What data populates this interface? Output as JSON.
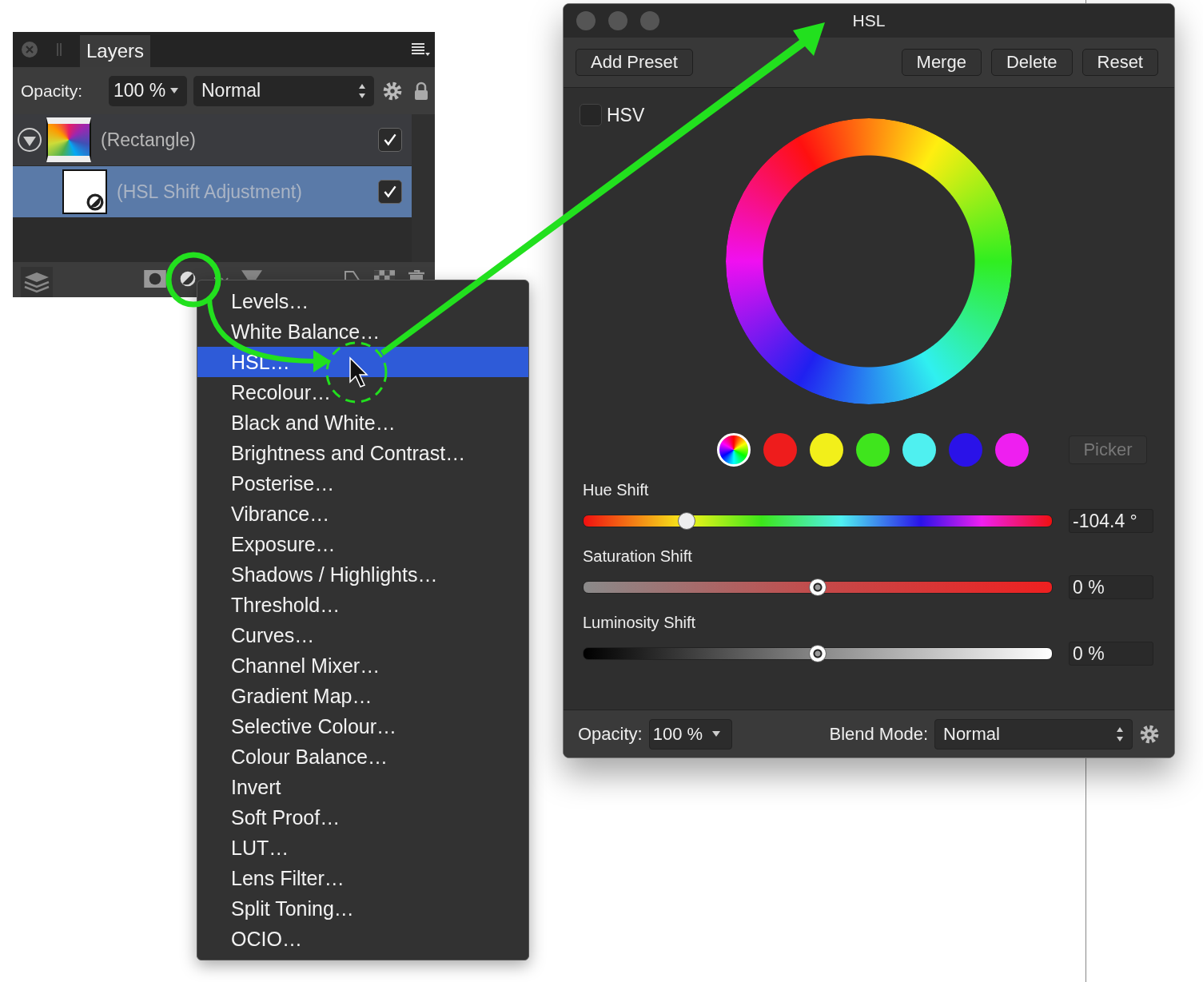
{
  "layers_panel": {
    "tab": "Layers",
    "opacity_label": "Opacity:",
    "opacity": "100 %",
    "blend_mode": "Normal",
    "layers": [
      {
        "kind": "shape",
        "name": "(Rectangle)",
        "expanded": true,
        "visible": true,
        "selected": false,
        "children": [
          {
            "kind": "adjustment",
            "name": "(HSL Shift Adjustment)",
            "visible": true,
            "selected": true
          }
        ]
      }
    ]
  },
  "menu": {
    "items": [
      {
        "label": "Levels…",
        "selected": false
      },
      {
        "label": "White Balance…",
        "selected": false
      },
      {
        "label": "HSL…",
        "selected": true
      },
      {
        "label": "Recolour…",
        "selected": false
      },
      {
        "label": "Black and White…",
        "selected": false
      },
      {
        "label": "Brightness and Contrast…",
        "selected": false
      },
      {
        "label": "Posterise…",
        "selected": false
      },
      {
        "label": "Vibrance…",
        "selected": false
      },
      {
        "label": "Exposure…",
        "selected": false
      },
      {
        "label": "Shadows / Highlights…",
        "selected": false
      },
      {
        "label": "Threshold…",
        "selected": false
      },
      {
        "label": "Curves…",
        "selected": false
      },
      {
        "label": "Channel Mixer…",
        "selected": false
      },
      {
        "label": "Gradient Map…",
        "selected": false
      },
      {
        "label": "Selective Colour…",
        "selected": false
      },
      {
        "label": "Colour Balance…",
        "selected": false
      },
      {
        "label": "Invert",
        "selected": false
      },
      {
        "label": "Soft Proof…",
        "selected": false
      },
      {
        "label": "LUT…",
        "selected": false
      },
      {
        "label": "Lens Filter…",
        "selected": false
      },
      {
        "label": "Split Toning…",
        "selected": false
      },
      {
        "label": "OCIO…",
        "selected": false
      }
    ]
  },
  "hsl_window": {
    "title": "HSL",
    "buttons": [
      "Add Preset",
      "Merge",
      "Delete",
      "Reset"
    ],
    "hsv": {
      "label": "HSV",
      "checked": false
    },
    "swatches": [
      {
        "kind": "wheel",
        "selected": true
      },
      {
        "kind": "color",
        "color": "#ee1c1c",
        "selected": false
      },
      {
        "kind": "color",
        "color": "#f2ef1a",
        "selected": false
      },
      {
        "kind": "color",
        "color": "#3fe51d",
        "selected": false
      },
      {
        "kind": "color",
        "color": "#4ff0f0",
        "selected": false
      },
      {
        "kind": "color",
        "color": "#2a12e8",
        "selected": false
      },
      {
        "kind": "color",
        "color": "#ee1ff0",
        "selected": false
      }
    ],
    "picker": "Picker",
    "sliders": [
      {
        "kind": "hue",
        "label": "Hue Shift",
        "level": 0.22,
        "reading": "-104.4 °"
      },
      {
        "kind": "saturation",
        "label": "Saturation Shift",
        "level": 0.5,
        "reading": "0 %"
      },
      {
        "kind": "luminosity",
        "label": "Luminosity Shift",
        "level": 0.5,
        "reading": "0 %"
      }
    ],
    "opacity_label": "Opacity:",
    "opacity": "100 %",
    "blend_label": "Blend Mode:",
    "blend_mode": "Normal"
  }
}
